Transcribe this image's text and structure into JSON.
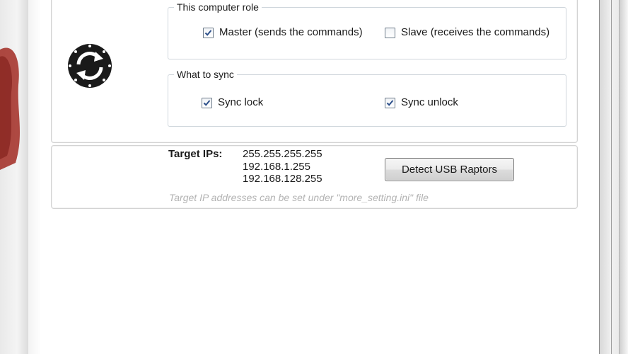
{
  "role_group": {
    "title": "This computer role",
    "master": {
      "label": "Master (sends the commands)",
      "checked": true
    },
    "slave": {
      "label": "Slave (receives the commands)",
      "checked": false
    }
  },
  "sync_group": {
    "title": "What to sync",
    "lock": {
      "label": "Sync lock",
      "checked": true
    },
    "unlock": {
      "label": "Sync unlock",
      "checked": true
    }
  },
  "target": {
    "label": "Target IPs:",
    "ips": [
      "255.255.255.255",
      "192.168.1.255",
      "192.168.128.255"
    ],
    "hint": "Target IP addresses can be set under \"more_setting.ini\" file"
  },
  "detect_button": {
    "label": "Detect USB Raptors"
  },
  "icons": {
    "logo": "sync-arrows-icon",
    "check": "checkmark-icon"
  },
  "colors": {
    "accent_red": "#b3261e",
    "check_blue": "#2c4f8a"
  }
}
